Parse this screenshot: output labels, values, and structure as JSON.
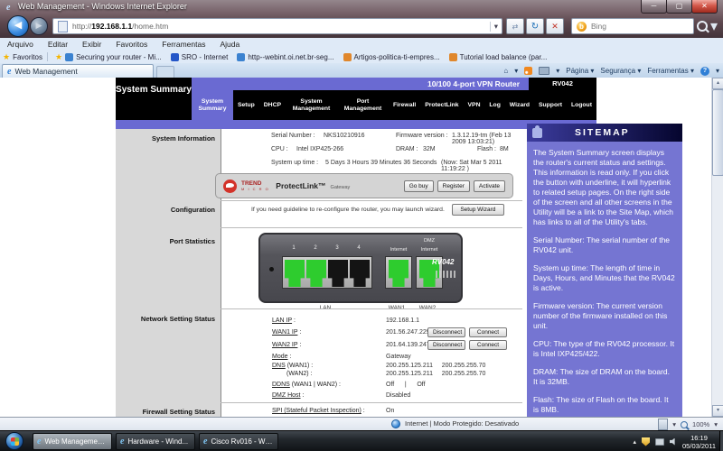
{
  "icons": {
    "dropdown": "▾",
    "up": "▴",
    "down": "▾",
    "back": "◀",
    "forward": "▶",
    "refresh": "↻",
    "stop": "✕",
    "close": "✕",
    "minimize": "─",
    "maximize": "▢",
    "home": "⌂",
    "compat": "⇄",
    "bing_b": "b",
    "help": "?",
    "star": "★",
    "e": "e"
  },
  "browser": {
    "window_title": "Web Management - Windows Internet Explorer",
    "address": {
      "prefix": "http://",
      "host": "192.168.1.1",
      "path": "/home.htm"
    },
    "search": {
      "engine": "Bing"
    },
    "menu": [
      "Arquivo",
      "Editar",
      "Exibir",
      "Favoritos",
      "Ferramentas",
      "Ajuda"
    ],
    "favorites_bar": {
      "label": "Favoritos",
      "links": [
        "Securing your router - Mi...",
        "SRO - Internet",
        "http--webint.oi.net.br-seg...",
        "Artigos-politica-ti-empres...",
        "Tutorial load balance (par..."
      ],
      "icon_colors": [
        "#3b82d0",
        "#2456c8",
        "#3b82d0",
        "#e0872c",
        "#e0872c"
      ]
    },
    "tab": "Web Management",
    "command_bar": {
      "page": "Página",
      "security": "Segurança",
      "tools": "Ferramentas"
    },
    "status_bar": {
      "zone": "Internet | Modo Protegido: Desativado",
      "zoom": "100%"
    }
  },
  "page": {
    "app_title": "System Summary",
    "product_title": "10/100 4-port VPN Router",
    "model": "RV042",
    "nav": [
      "System Summary",
      "Setup",
      "DHCP",
      "System Management",
      "Port Management",
      "Firewall",
      "ProtectLink",
      "VPN",
      "Log",
      "Wizard",
      "Support",
      "Logout"
    ],
    "section_labels": [
      "System Information",
      "Configuration",
      "Port Statistics",
      "Network Setting Status",
      "Firewall Setting Status"
    ],
    "system_info": {
      "serial_label": "Serial Number :",
      "serial": "NKS10210916",
      "firmware_label": "Firmware version :",
      "firmware": "1.3.12.19-tm (Feb 13 2009 13:03:21)",
      "cpu_label": "CPU :",
      "cpu": "Intel IXP425-266",
      "dram_label": "DRAM :",
      "dram": "32M",
      "flash_label": "Flash :",
      "flash": "8M",
      "uptime_label": "System up time :",
      "uptime": "5 Days 3 Hours 39 Minutes 36 Seconds",
      "now": "(Now: Sat Mar 5 2011 11:19:22 )"
    },
    "protectlink": {
      "brand_top": "TREND",
      "brand_bottom": "M I C R O",
      "product": "ProtectLink™",
      "suffix": "Gateway",
      "buttons": [
        "Go buy",
        "Register",
        "Activate"
      ]
    },
    "configuration": {
      "text": "If you need guideline to re-configure the router, you may launch wizard.",
      "button": "Setup Wizard"
    },
    "router": {
      "model": "RV042",
      "port_numbers": [
        "1",
        "2",
        "3",
        "4"
      ],
      "wan1_label": "Internet",
      "wan2_label_top": "DMZ",
      "wan2_label": "Internet",
      "group_labels": [
        "LAN",
        "WAN1",
        "WAN2"
      ]
    },
    "network_status": {
      "rows": [
        {
          "link": "LAN IP",
          "rest": " :",
          "value": "192.168.1.1"
        },
        {
          "link": "WAN1 IP",
          "rest": " :",
          "value": "201.56.247.229"
        },
        {
          "link": "WAN2 IP",
          "rest": " :",
          "value": "201.64.139.247"
        },
        {
          "link": "Mode",
          "rest": " :",
          "value": "Gateway"
        },
        {
          "link": "DNS",
          "rest": " (WAN1) :",
          "value": "200.255.125.211     200.255.255.70"
        },
        {
          "link": "",
          "rest": "(WAN2) :",
          "value": "200.255.125.211     200.255.255.70"
        },
        {
          "link": "DDNS",
          "rest": " (WAN1  |  WAN2) :",
          "value": "Off      |      Off"
        },
        {
          "link": "DMZ Host",
          "rest": " :",
          "value": "Disabled"
        }
      ],
      "disconnect": "Disconnect",
      "connect": "Connect"
    },
    "firewall_status": {
      "link": "SPI (Stateful Packet Inspection)",
      "rest": " :",
      "value": "On"
    },
    "sitemap": {
      "title": "SITEMAP",
      "paragraphs": [
        "The System Summary screen displays the router's current status and settings. This information is read only. If you click the button with underline, it will hyperlink to related setup pages. On the right side of the screen and all other screens in the Utility will be a link to the Site Map, which has links to all of the Utility's tabs.",
        "Serial Number: The serial number of the RV042 unit.",
        "System up time: The length of time in Days, Hours, and Minutes that the RV042 is active.",
        "Firmware version: The current version number of the firmware installed on this unit.",
        "CPU: The type of the RV042 processor. It is Intel IXP425/422.",
        "DRAM: The size of DRAM on the board. It is 32MB.",
        "Flash: The size of Flash on the board. It is 8MB."
      ]
    }
  },
  "taskbar": {
    "windows": [
      "Web Managemen...",
      "Hardware - Wind...",
      "Cisco Rv016 - Win..."
    ],
    "time": "16:19",
    "date": "05/03/2011"
  }
}
